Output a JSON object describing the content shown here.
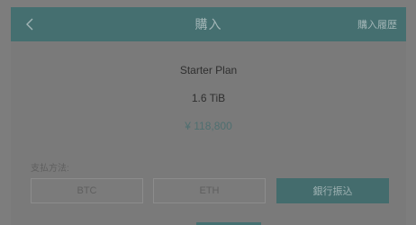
{
  "header": {
    "title": "購入",
    "right_link": "購入履歴"
  },
  "plan": {
    "name": "Starter Plan",
    "size": "1.6 TiB",
    "price": "¥ 118,800"
  },
  "payment": {
    "label": "支払方法:",
    "options": [
      {
        "label": "BTC",
        "selected": false
      },
      {
        "label": "ETH",
        "selected": false
      },
      {
        "label": "銀行振込",
        "selected": true
      }
    ]
  },
  "colors": {
    "accent": "#456f70",
    "overlay_background": "#7d7d7d",
    "price_text": "#4f6f70"
  },
  "icons": {
    "back": "chevron-left-icon"
  }
}
